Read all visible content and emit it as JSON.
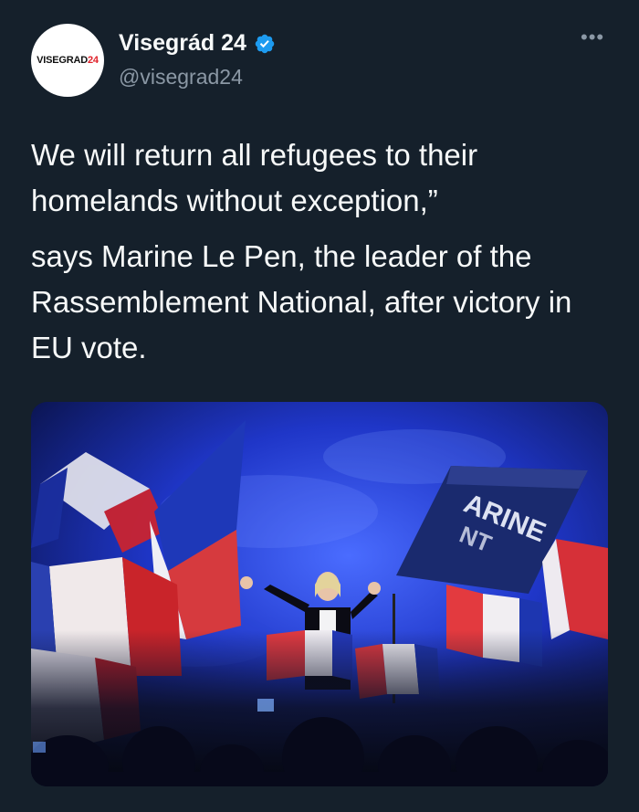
{
  "tweet": {
    "avatar": {
      "logo_text": "VISEGRAD",
      "logo_number": "24"
    },
    "author": {
      "display_name": "Visegrád 24",
      "handle": "@visegrad24",
      "verified_icon": "verified-badge-icon"
    },
    "more_icon": "more-dots-icon",
    "text": {
      "paragraph_1": "We will return all refugees to their homelands without exception,”",
      "paragraph_2": "says Marine Le Pen, the leader of the Rassemblement National, after victory in EU vote."
    },
    "media": {
      "sign_text_line1": "ARINE",
      "sign_text_line2": "NT"
    }
  },
  "colors": {
    "background": "#15202b",
    "text": "#f7f9f9",
    "secondary": "#8b98a5",
    "verified": "#1d9bf0"
  }
}
